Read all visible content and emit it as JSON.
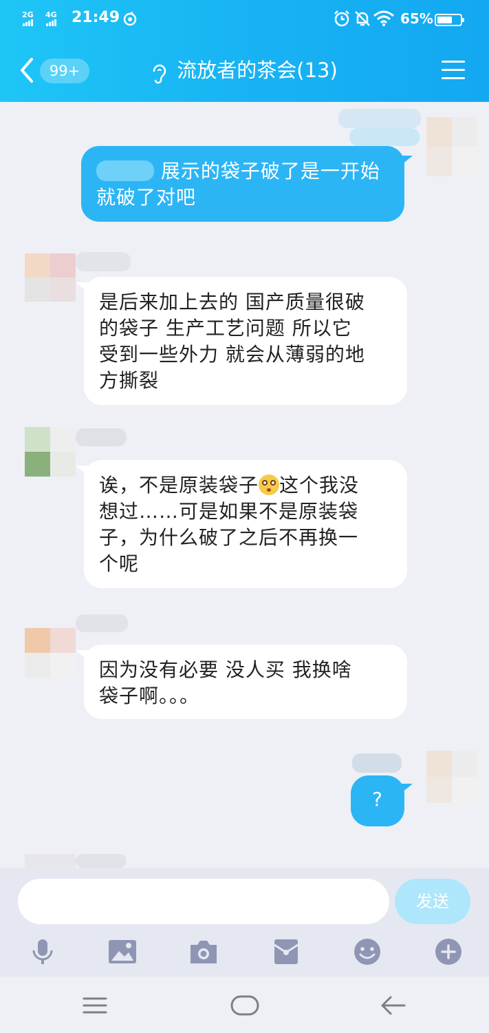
{
  "status_bar": {
    "network_1": "2G",
    "network_2": "4G",
    "time": "21:49",
    "battery_percent": "65%",
    "battery_level": 0.65
  },
  "header": {
    "unread_count": "99+",
    "group_title": "流放者的茶会(13)"
  },
  "messages": [
    {
      "side": "out",
      "text_line1": "展示的袋子破了是一开始",
      "text_line2": "就破了对吧"
    },
    {
      "side": "in",
      "lines": [
        "是后来加上去的 国产质量很破",
        "的袋子  生产工艺问题 所以它",
        "受到一些外力 就会从薄弱的地",
        "方撕裂"
      ]
    },
    {
      "side": "in",
      "line1_a": "诶，不是原装袋子",
      "line1_b": "这个我没",
      "lines": [
        "想过……可是如果不是原装袋",
        "子，为什么破了之后不再换一",
        "个呢"
      ]
    },
    {
      "side": "in",
      "lines": [
        "因为没有必要 没人买 我换啥",
        "袋子啊。。。"
      ]
    },
    {
      "side": "out",
      "text": "?"
    }
  ],
  "input": {
    "placeholder": "",
    "value": "",
    "send_label": "发送"
  },
  "toolbar": [
    "microphone-icon",
    "image-icon",
    "camera-icon",
    "red-packet-icon",
    "emoji-icon",
    "plus-icon"
  ],
  "colors": {
    "header_start": "#1ec6f6",
    "header_end": "#13a8f1",
    "outgoing_bubble": "#2cb5f5",
    "incoming_bubble": "#ffffff",
    "chat_bg": "#eef0f6",
    "send_disabled": "#aee6fc",
    "toolbar_icon": "#8e96b4"
  }
}
